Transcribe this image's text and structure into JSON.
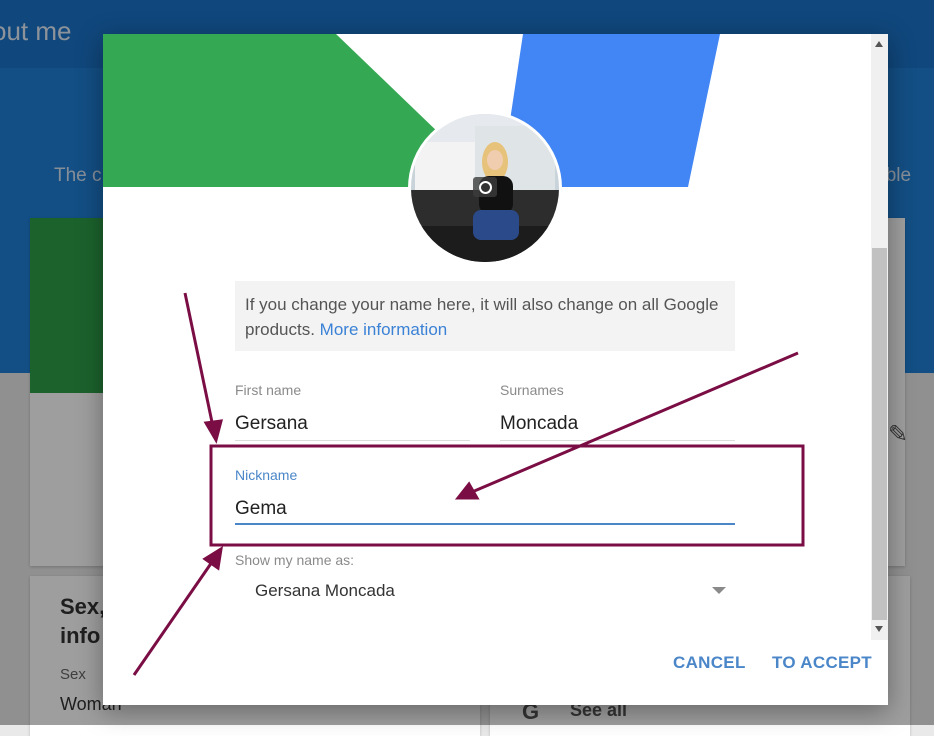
{
  "background": {
    "page_title": "out me",
    "band_text_left": "The c",
    "band_text_right": "sible",
    "section_heading": "Sex, info",
    "sex_label": "Sex",
    "sex_value": "Woman",
    "see_all_label": "See all",
    "google_glyph": "G"
  },
  "dialog": {
    "info_text": "If you change your name here, it will also change on all Google products.",
    "info_link": "More information",
    "first_name": {
      "label": "First name",
      "value": "Gersana"
    },
    "surnames": {
      "label": "Surnames",
      "value": "Moncada"
    },
    "nickname": {
      "label": "Nickname",
      "value": "Gema"
    },
    "show_name_as": {
      "label": "Show my name as:",
      "value": "Gersana Moncada"
    },
    "cancel_label": "CANCEL",
    "accept_label": "TO ACCEPT"
  },
  "icons": [
    "camera-icon",
    "chevron-down-icon",
    "pencil-icon",
    "scroll-up-icon",
    "scroll-down-icon"
  ],
  "colors": {
    "brand_blue": "#1f7fd6",
    "hero_green": "#34a853",
    "hero_blue": "#4285f4",
    "accent": "#4a86c8",
    "annotation": "#7b0d45"
  }
}
